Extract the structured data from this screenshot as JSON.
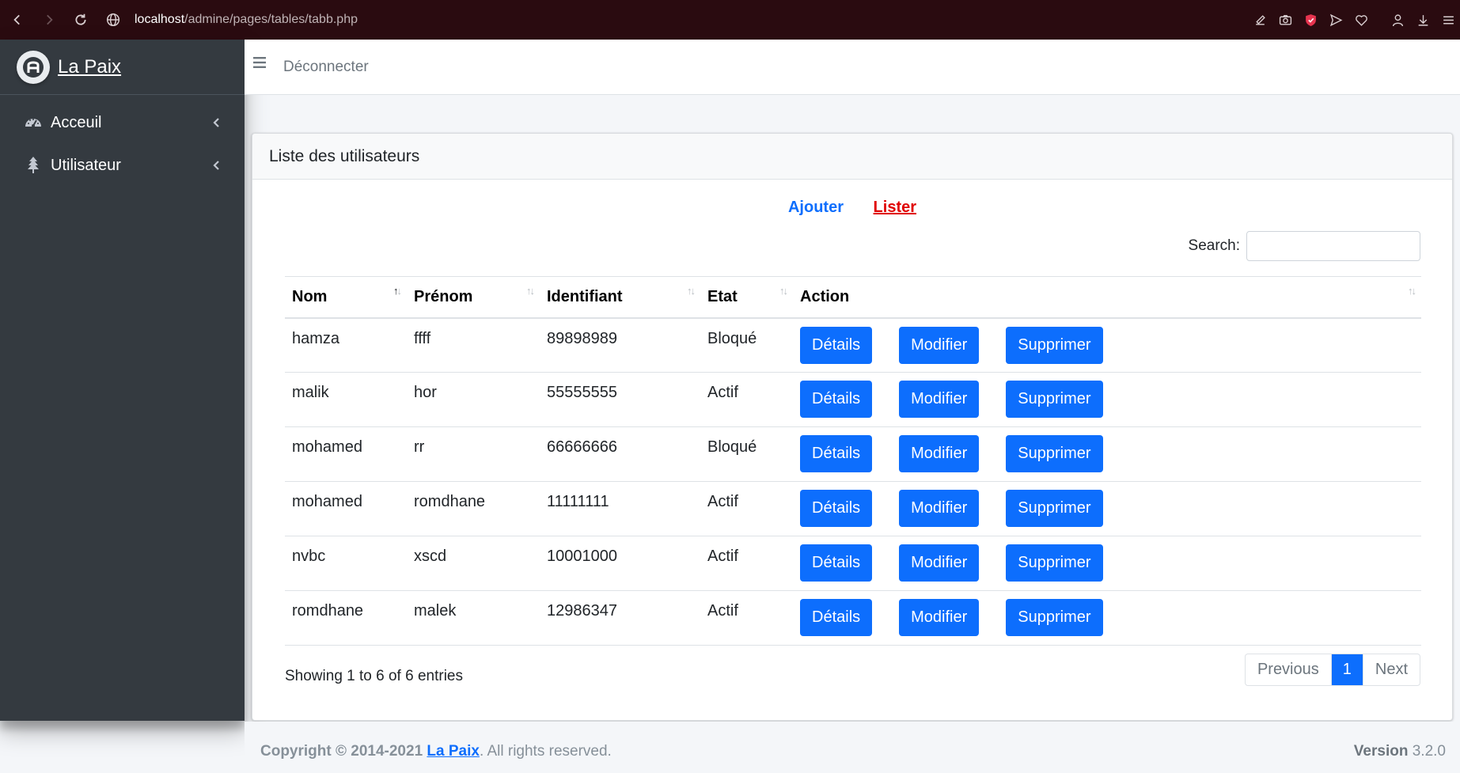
{
  "browser": {
    "url_host": "localhost",
    "url_path": "/admine/pages/tables/tabb.php"
  },
  "sidebar": {
    "brand": "La Paix",
    "items": [
      {
        "label": "Acceuil",
        "icon": "tachometer-icon"
      },
      {
        "label": "Utilisateur",
        "icon": "tree-icon"
      }
    ]
  },
  "topbar": {
    "logout_label": "Déconnecter"
  },
  "card": {
    "title": "Liste des utilisateurs",
    "link_add": "Ajouter",
    "link_list": "Lister",
    "search_label": "Search:",
    "search_value": ""
  },
  "table": {
    "columns": [
      "Nom",
      "Prénom",
      "Identifiant",
      "Etat",
      "Action"
    ],
    "rows": [
      {
        "nom": "hamza",
        "prenom": "ffff",
        "id": "89898989",
        "etat": "Bloqué"
      },
      {
        "nom": "malik",
        "prenom": "hor",
        "id": "55555555",
        "etat": "Actif"
      },
      {
        "nom": "mohamed",
        "prenom": "rr",
        "id": "66666666",
        "etat": "Bloqué"
      },
      {
        "nom": "mohamed",
        "prenom": "romdhane",
        "id": "11111111",
        "etat": "Actif"
      },
      {
        "nom": "nvbc",
        "prenom": "xscd",
        "id": "10001000",
        "etat": "Actif"
      },
      {
        "nom": "romdhane",
        "prenom": "malek",
        "id": "12986347",
        "etat": "Actif"
      }
    ],
    "btn_details": "Détails",
    "btn_modifier": "Modifier",
    "btn_supprimer": "Supprimer"
  },
  "pagination": {
    "info": "Showing 1 to 6 of 6 entries",
    "previous": "Previous",
    "current": "1",
    "next": "Next"
  },
  "footer": {
    "copyright": "Copyright © 2014-2021",
    "brand": "La Paix",
    "rights": ". All rights reserved.",
    "version_label": "Version",
    "version": "3.2.0"
  },
  "colors": {
    "primary": "#0d6efd",
    "sidebar": "#343a40",
    "list_link": "#e00000",
    "browser_bar": "#2a0b10"
  }
}
